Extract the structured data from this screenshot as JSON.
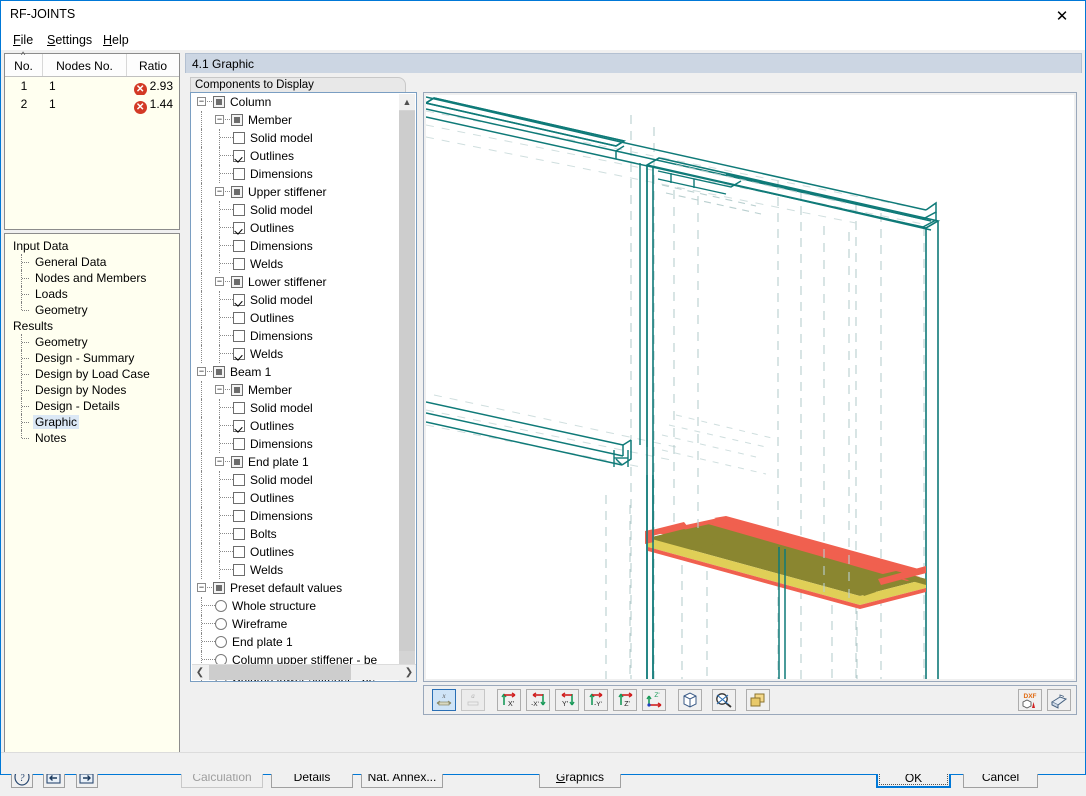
{
  "window": {
    "title": "RF-JOINTS",
    "close_label": "✕"
  },
  "menu": {
    "items": [
      {
        "label": "File",
        "accel": "F"
      },
      {
        "label": "Settings",
        "accel": "S"
      },
      {
        "label": "Help",
        "accel": "H"
      }
    ]
  },
  "results_table": {
    "columns": [
      "No.",
      "Nodes No.",
      "Ratio"
    ],
    "rows": [
      {
        "no": "1",
        "nodes_no": "1",
        "ratio": "2.93",
        "status": "error"
      },
      {
        "no": "2",
        "nodes_no": "1",
        "ratio": "1.44",
        "status": "error"
      }
    ],
    "error_glyph": "✕",
    "error_color": "#d33a26"
  },
  "nav": {
    "groups": [
      {
        "label": "Input Data",
        "items": [
          "General Data",
          "Nodes and Members",
          "Loads",
          "Geometry"
        ]
      },
      {
        "label": "Results",
        "items": [
          "Geometry",
          "Design - Summary",
          "Design by Load Case",
          "Design by Nodes",
          "Design - Details",
          "Graphic",
          "Notes"
        ],
        "selected": "Graphic"
      }
    ]
  },
  "left_icon_buttons": [
    {
      "name": "help-button",
      "glyph": "?"
    },
    {
      "name": "import-button",
      "glyph": "⇦"
    },
    {
      "name": "export-button",
      "glyph": "⇨"
    }
  ],
  "panel": {
    "header": "4.1 Graphic",
    "components_label": "Components to Display"
  },
  "tree": {
    "nodes": [
      {
        "depth": 0,
        "type": "group",
        "label": "Column",
        "expanded": true
      },
      {
        "depth": 1,
        "type": "group",
        "label": "Member",
        "expanded": true
      },
      {
        "depth": 2,
        "type": "checkbox",
        "label": "Solid model",
        "checked": false
      },
      {
        "depth": 2,
        "type": "checkbox",
        "label": "Outlines",
        "checked": true
      },
      {
        "depth": 2,
        "type": "checkbox",
        "label": "Dimensions",
        "checked": false
      },
      {
        "depth": 1,
        "type": "group",
        "label": "Upper stiffener",
        "expanded": true
      },
      {
        "depth": 2,
        "type": "checkbox",
        "label": "Solid model",
        "checked": false
      },
      {
        "depth": 2,
        "type": "checkbox",
        "label": "Outlines",
        "checked": true
      },
      {
        "depth": 2,
        "type": "checkbox",
        "label": "Dimensions",
        "checked": false
      },
      {
        "depth": 2,
        "type": "checkbox",
        "label": "Welds",
        "checked": false
      },
      {
        "depth": 1,
        "type": "group",
        "label": "Lower stiffener",
        "expanded": true
      },
      {
        "depth": 2,
        "type": "checkbox",
        "label": "Solid model",
        "checked": true
      },
      {
        "depth": 2,
        "type": "checkbox",
        "label": "Outlines",
        "checked": false
      },
      {
        "depth": 2,
        "type": "checkbox",
        "label": "Dimensions",
        "checked": false
      },
      {
        "depth": 2,
        "type": "checkbox",
        "label": "Welds",
        "checked": true
      },
      {
        "depth": 0,
        "type": "group",
        "label": "Beam 1",
        "expanded": true
      },
      {
        "depth": 1,
        "type": "group",
        "label": "Member",
        "expanded": true
      },
      {
        "depth": 2,
        "type": "checkbox",
        "label": "Solid model",
        "checked": false
      },
      {
        "depth": 2,
        "type": "checkbox",
        "label": "Outlines",
        "checked": true
      },
      {
        "depth": 2,
        "type": "checkbox",
        "label": "Dimensions",
        "checked": false
      },
      {
        "depth": 1,
        "type": "group",
        "label": "End plate 1",
        "expanded": true
      },
      {
        "depth": 2,
        "type": "checkbox",
        "label": "Solid model",
        "checked": false
      },
      {
        "depth": 2,
        "type": "checkbox",
        "label": "Outlines",
        "checked": false
      },
      {
        "depth": 2,
        "type": "checkbox",
        "label": "Dimensions",
        "checked": false
      },
      {
        "depth": 2,
        "type": "checkbox",
        "label": "Bolts",
        "checked": false
      },
      {
        "depth": 2,
        "type": "checkbox",
        "label": "Outlines",
        "checked": false
      },
      {
        "depth": 2,
        "type": "checkbox",
        "label": "Welds",
        "checked": false
      },
      {
        "depth": 0,
        "type": "group",
        "label": "Preset default values",
        "expanded": true
      },
      {
        "depth": 1,
        "type": "radio",
        "label": "Whole structure",
        "checked": false
      },
      {
        "depth": 1,
        "type": "radio",
        "label": "Wireframe",
        "checked": false
      },
      {
        "depth": 1,
        "type": "radio",
        "label": "End plate 1",
        "checked": false
      },
      {
        "depth": 1,
        "type": "radio",
        "label": "Column upper stiffener - be",
        "checked": false
      },
      {
        "depth": 1,
        "type": "radio",
        "label": "Column lower stiffener - be",
        "checked": false
      }
    ]
  },
  "graphic_toolbar": {
    "buttons": [
      {
        "name": "view-x-button",
        "label": "x",
        "state": "selected"
      },
      {
        "name": "view-a-button",
        "label": "a",
        "state": "disabled"
      },
      {
        "name": "view-x-axis-button",
        "label": "X'",
        "state": "normal"
      },
      {
        "name": "view-neg-x-button",
        "label": "-X'",
        "state": "normal"
      },
      {
        "name": "view-y-axis-button",
        "label": "Y'",
        "state": "normal"
      },
      {
        "name": "view-neg-y-button",
        "label": "-Y'",
        "state": "normal"
      },
      {
        "name": "view-z-axis-button",
        "label": "Z'",
        "state": "normal"
      },
      {
        "name": "view-neg-z-button",
        "label": "-Z'",
        "state": "normal"
      },
      {
        "name": "isometric-view-button",
        "label": "",
        "state": "normal"
      },
      {
        "name": "zoom-reset-button",
        "label": "",
        "state": "normal"
      },
      {
        "name": "render-mode-button",
        "label": "",
        "state": "normal"
      }
    ],
    "right_buttons": [
      {
        "name": "dxf-export-button",
        "label": "DXF"
      },
      {
        "name": "print-button",
        "label": "print"
      }
    ]
  },
  "action_bar": {
    "calculation": "Calculation",
    "details": "Details",
    "nat_annex": "Nat. Annex...",
    "graphics": "Graphics",
    "graphics_accel": "G",
    "ok": "OK",
    "cancel": "Cancel"
  },
  "colors": {
    "outline": "#0f7a78",
    "hidden_line": "#b9cfcf",
    "solid_fill": "#8a8630",
    "weld_red": "#f0604f",
    "plate_yellow": "#e0cf57",
    "accent": "#0078d7",
    "panel_header": "#ccd6e3"
  }
}
